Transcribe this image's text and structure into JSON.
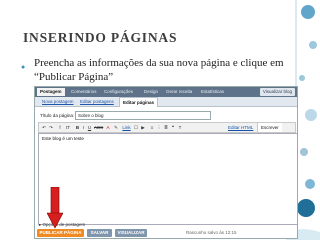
{
  "slide": {
    "title": "INSERINDO PÁGINAS",
    "bullet_text": "Preencha as informações da sua nova página e clique em “Publicar Página”"
  },
  "screenshot": {
    "top_tabs": [
      "Postagem",
      "Comentários",
      "Configurações",
      "Design",
      "Gerar receita",
      "Estatísticas"
    ],
    "top_link": "Visualizar blog",
    "sub_tabs": [
      "Nova postagem",
      "Editar postagens",
      "Editar páginas"
    ],
    "title_label": "Título da página:",
    "title_value": "Sobre o blog",
    "toolbar_items": [
      "↶",
      "↷",
      "f",
      "tT",
      "B",
      "I",
      "U",
      "ABC",
      "A",
      "✎",
      "Link",
      "☐",
      "▶",
      "≡",
      "⋮",
      "≣",
      "❝",
      "T"
    ],
    "mode_buttons": [
      "Editar HTML",
      "Escrever"
    ],
    "editor_text": "Este blog é um teste",
    "options_label": "▸ Opções de postagem",
    "publish_button": "PUBLICAR PÁGINA",
    "save_button": "SALVAR",
    "preview_button": "VISUALIZAR",
    "status_text": "Rascunho salvo às 12:15",
    "colors": {
      "accent_blue": "#3a8fbd",
      "topbar": "#5e7289",
      "publish": "#f08a24",
      "save": "#7f96ad",
      "preview": "#7f96ad",
      "arrow": "#d81f1f"
    }
  }
}
